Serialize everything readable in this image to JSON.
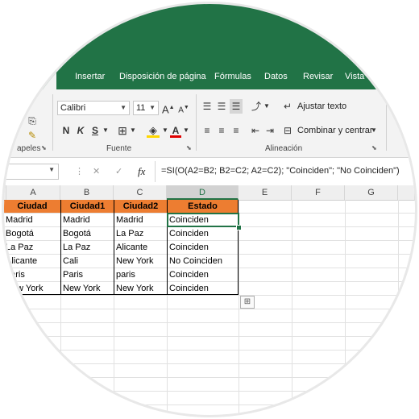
{
  "ribbon_tabs": [
    "io",
    "Insertar",
    "Disposición de página",
    "Fórmulas",
    "Datos",
    "Revisar",
    "Vista"
  ],
  "font": {
    "name": "Calibri",
    "size": "11"
  },
  "buttons": {
    "bold": "N",
    "italic": "K",
    "underline": "S",
    "grow": "A",
    "shrink": "A",
    "font_color": "A",
    "wrap_text": "Ajustar texto",
    "merge_center": "Combinar y centrar"
  },
  "group_labels": {
    "clipboard": "apeles",
    "font": "Fuente",
    "alignment": "Alineación"
  },
  "formula_bar": {
    "cancel": "✕",
    "enter": "✓",
    "fx": "fx",
    "formula": "=SI(O(A2=B2; B2=C2; A2=C2); \"Coinciden\"; \"No Coinciden\")"
  },
  "columns": [
    "A",
    "B",
    "C",
    "D",
    "E",
    "F",
    "G"
  ],
  "selected_column": "D",
  "table": {
    "headers": [
      "Ciudad",
      "Ciudad1",
      "Ciudad2",
      "Estado"
    ],
    "rows": [
      [
        "Madrid",
        "Madrid",
        "Madrid",
        "Coinciden"
      ],
      [
        "Bogotá",
        "Bogotá",
        "La Paz",
        "Coinciden"
      ],
      [
        "La Paz",
        "La Paz",
        "Alicante",
        "Coinciden"
      ],
      [
        "Alicante",
        "Cali",
        "New York",
        "No Coinciden"
      ],
      [
        "paris",
        "Paris",
        "paris",
        "Coinciden"
      ],
      [
        "New York",
        "New York",
        "New York",
        "Coinciden"
      ]
    ],
    "header_color": "#ed7d31"
  },
  "colors": {
    "ribbon_green": "#217346",
    "ribbon_body": "#f3f3f3",
    "accent": "#217346"
  }
}
